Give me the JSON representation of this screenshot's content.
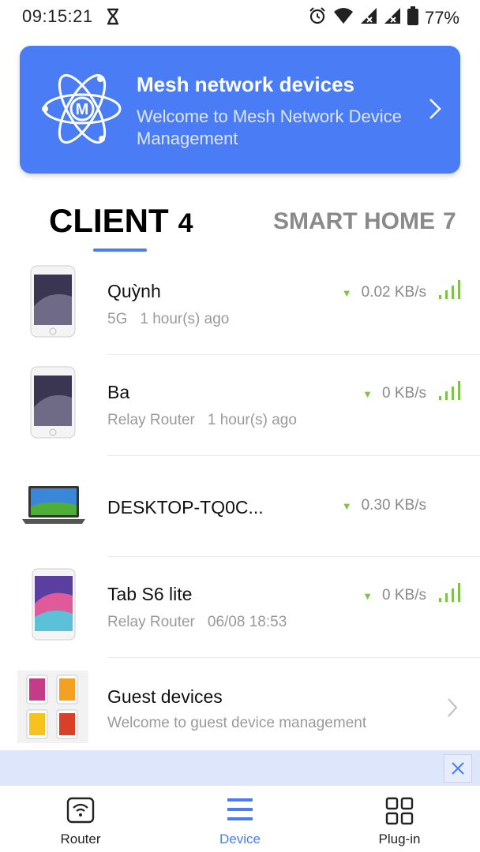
{
  "status_bar": {
    "time": "09:15:21",
    "battery": "77%"
  },
  "banner": {
    "title": "Mesh network devices",
    "subtitle": "Welcome to Mesh Network Device Management",
    "logo_letter": "M"
  },
  "tabs": {
    "client": {
      "label": "CLIENT",
      "count": "4"
    },
    "smart_home": {
      "label": "SMART HOME",
      "count": "7"
    }
  },
  "devices": [
    {
      "name": "Quỳnh",
      "band": "5G",
      "last_seen": "1 hour(s) ago",
      "speed": "0.02 KB/s",
      "type": "phone",
      "signal_bars": 4
    },
    {
      "name": "Ba",
      "band": "Relay Router",
      "last_seen": "1 hour(s) ago",
      "speed": "0 KB/s",
      "type": "phone",
      "signal_bars": 4
    },
    {
      "name": "DESKTOP-TQ0C...",
      "band": "",
      "last_seen": "",
      "speed": "0.30 KB/s",
      "type": "laptop",
      "signal_bars": 0
    },
    {
      "name": "Tab S6 lite",
      "band": "Relay Router",
      "last_seen": "06/08 18:53",
      "speed": "0 KB/s",
      "type": "tablet",
      "signal_bars": 4
    }
  ],
  "guest": {
    "title": "Guest devices",
    "subtitle": "Welcome to guest device management"
  },
  "bottom_nav": [
    {
      "label": "Router",
      "icon": "wifi-router-icon",
      "active": false
    },
    {
      "label": "Device",
      "icon": "menu-icon",
      "active": true
    },
    {
      "label": "Plug-in",
      "icon": "grid-icon",
      "active": false
    }
  ],
  "colors": {
    "accent": "#4a7df5",
    "signal_green": "#7cc44a",
    "ad_strip": "#dde6fb"
  }
}
